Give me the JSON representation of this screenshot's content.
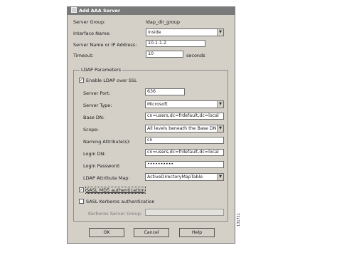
{
  "dialog": {
    "title": "Add AAA Server"
  },
  "fields": {
    "server_group_label": "Server Group:",
    "server_group_value": "ldap_dir_group",
    "interface_label": "Interface Name:",
    "interface_value": "inside",
    "server_name_label": "Server Name or IP Address:",
    "server_name_value": "10.1.1.2",
    "timeout_label": "Timeout:",
    "timeout_value": "10",
    "timeout_unit": "seconds"
  },
  "ldap": {
    "group_title": "LDAP Parameters",
    "enable_ssl_label": "Enable LDAP over SSL",
    "enable_ssl_checked": true,
    "server_port_label": "Server Port:",
    "server_port_value": "636",
    "server_type_label": "Server Type:",
    "server_type_value": "Microsoft",
    "base_dn_label": "Base DN:",
    "base_dn_value": "cn=users,dc=frdefault,dc=local",
    "scope_label": "Scope:",
    "scope_value": "All levels beneath the Base DN",
    "naming_attr_label": "Naming Attribute(s):",
    "naming_attr_value": "cn",
    "login_dn_label": "Login DN:",
    "login_dn_value": "cn=users,dc=frdefault,dc=local",
    "login_password_label": "Login Password:",
    "login_password_value": "••••••••••",
    "attr_map_label": "LDAP Attribute Map:",
    "attr_map_value": "ActiveDirectoryMapTable",
    "sasl_md5_label": "SASL MD5 authentication",
    "sasl_md5_checked": true,
    "sasl_kerberos_label": "SASL Kerberos authentication",
    "sasl_kerberos_checked": false,
    "kerberos_group_label": "Kerberos Server Group:",
    "kerberos_group_value": ""
  },
  "buttons": {
    "ok": "OK",
    "cancel": "Cancel",
    "help": "Help"
  },
  "figure_id": "131711"
}
